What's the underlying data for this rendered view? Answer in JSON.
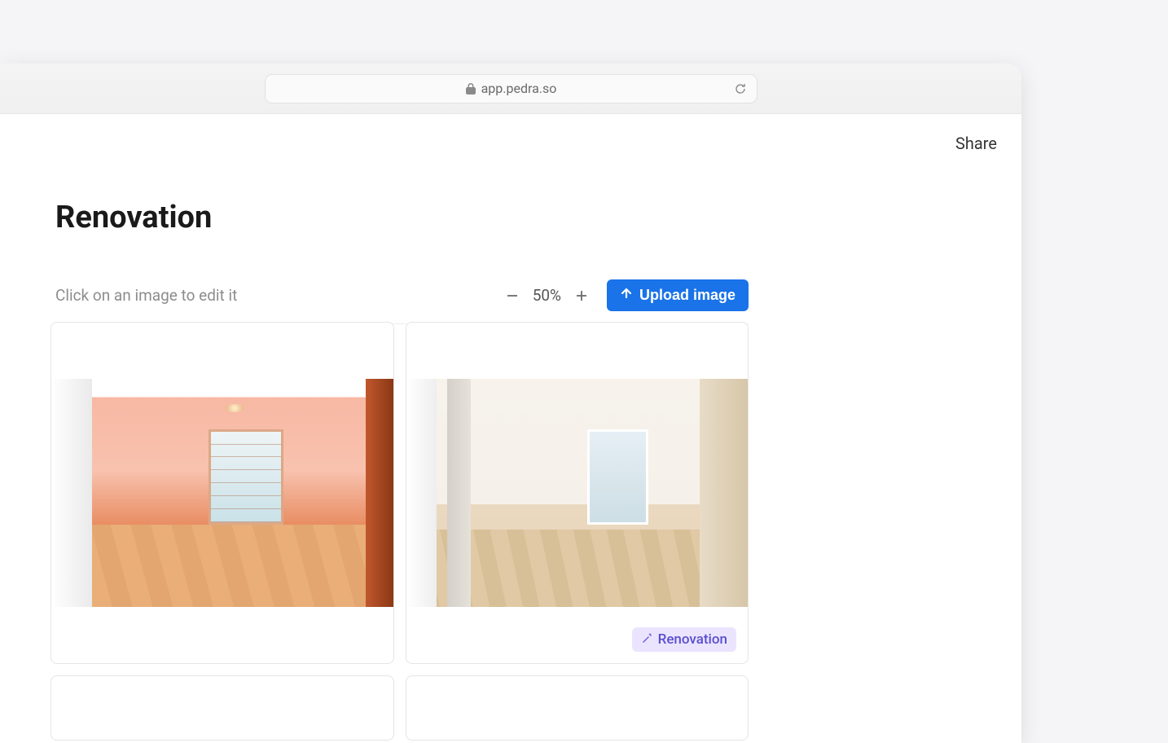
{
  "browser": {
    "url": "app.pedra.so"
  },
  "header": {
    "share_label": "Share"
  },
  "page": {
    "title": "Renovation",
    "hint": "Click on an image to edit it"
  },
  "zoom": {
    "level": "50%"
  },
  "toolbar": {
    "upload_label": "Upload image"
  },
  "images": [
    {
      "badge": null
    },
    {
      "badge": "Renovation"
    }
  ]
}
